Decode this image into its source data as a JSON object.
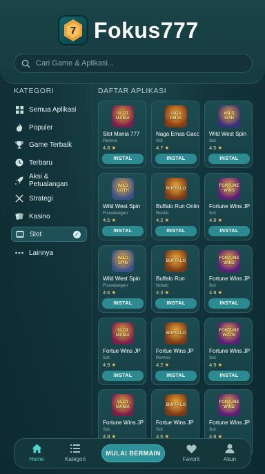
{
  "brand": {
    "name": "Fokus777",
    "logo_digit": "7"
  },
  "search": {
    "placeholder": "Cari Game & Aplikasi..."
  },
  "sidebar": {
    "title": "KATEGORI",
    "items": [
      {
        "label": "Semua Aplikasi",
        "icon": "grid-icon"
      },
      {
        "label": "Populer",
        "icon": "fire-icon"
      },
      {
        "label": "Game Terbaik",
        "icon": "trophy-icon"
      },
      {
        "label": "Terbaru",
        "icon": "clock-icon"
      },
      {
        "label": "Aksi & Petualangan",
        "icon": "rocket-icon"
      },
      {
        "label": "Strategi",
        "icon": "swords-icon"
      },
      {
        "label": "Kasino",
        "icon": "cards-icon"
      },
      {
        "label": "Slot",
        "icon": "slot-icon",
        "active": true
      },
      {
        "label": "Lainnya",
        "icon": "dots-icon"
      }
    ]
  },
  "main": {
    "title": "DAFTAR APLIKASI",
    "install_label": "INSTAL",
    "apps": [
      {
        "name": "Slot Mania 777",
        "sub": "Remno",
        "rating": "4.8",
        "thumb": "SLOT\nMANIA",
        "color": "#7a1f4b"
      },
      {
        "name": "Naga Emas Gacor",
        "sub": "Sot",
        "rating": "4.7",
        "thumb": "GIGA\nEMAS",
        "color": "#8a3b16"
      },
      {
        "name": "Wild West Spin",
        "sub": "Sot",
        "rating": "4.5",
        "thumb": "WILD\nSPIN",
        "color": "#3a2f7c"
      },
      {
        "name": "Wild West Spin",
        "sub": "Fisredangen",
        "rating": "4.5",
        "thumb": "WILD\nGOTH",
        "color": "#39508a"
      },
      {
        "name": "Buffalo Run Online",
        "sub": "Restio",
        "rating": "4.2",
        "thumb": "BUFFALO",
        "color": "#7b3a17"
      },
      {
        "name": "Fortune Wins JP",
        "sub": "Sot",
        "rating": "4.9",
        "thumb": "FORTUNE\nWINS",
        "color": "#5b1e7a"
      },
      {
        "name": "Wild West Spin",
        "sub": "Fisredangen",
        "rating": "4.6",
        "thumb": "WILD\nSPIN",
        "color": "#39508a"
      },
      {
        "name": "Buffalo Run",
        "sub": "Notaic",
        "rating": "4.3",
        "thumb": "BUFFALO",
        "color": "#7b3a17"
      },
      {
        "name": "Fortune Wins JP",
        "sub": "Sot",
        "rating": "4.9",
        "thumb": "FORTUNE\nWINS",
        "color": "#5b1e7a"
      },
      {
        "name": "Fortue Wins JP",
        "sub": "Sot",
        "rating": "4.9",
        "thumb": "SLOT\nMANIA",
        "color": "#7a1f4b"
      },
      {
        "name": "Fortue Wins JP",
        "sub": "Remno",
        "rating": "4.2",
        "thumb": "BUFFALO",
        "color": "#7b3a17"
      },
      {
        "name": "Fortune Wins JP",
        "sub": "Sot",
        "rating": "4.9",
        "thumb": "FORTUNE\nWOOS",
        "color": "#5b1e7a"
      },
      {
        "name": "Fortune Wins JP",
        "sub": "Sot",
        "rating": "4.9",
        "thumb": "SLOT\nMANIA",
        "color": "#7a1f4b"
      },
      {
        "name": "Fortue Wins JP",
        "sub": "Sot",
        "rating": "4.5",
        "thumb": "BUFFALO",
        "color": "#7b3a17"
      },
      {
        "name": "Fortune Wins JP",
        "sub": "Sot",
        "rating": "4.9",
        "thumb": "FORTUNE\nWINS",
        "color": "#5b1e7a"
      }
    ]
  },
  "bottom_nav": {
    "items": [
      {
        "label": "Home",
        "icon": "home-icon",
        "active": true
      },
      {
        "label": "Kategori",
        "icon": "list-icon"
      },
      {
        "label": "Favorit",
        "icon": "heart-icon"
      },
      {
        "label": "Akun",
        "icon": "user-icon"
      }
    ],
    "play_label": "MULAI BERMAIN"
  },
  "colors": {
    "accent": "#2c8b91",
    "active_nav": "#4fd3d2",
    "star": "#f3c84a"
  }
}
